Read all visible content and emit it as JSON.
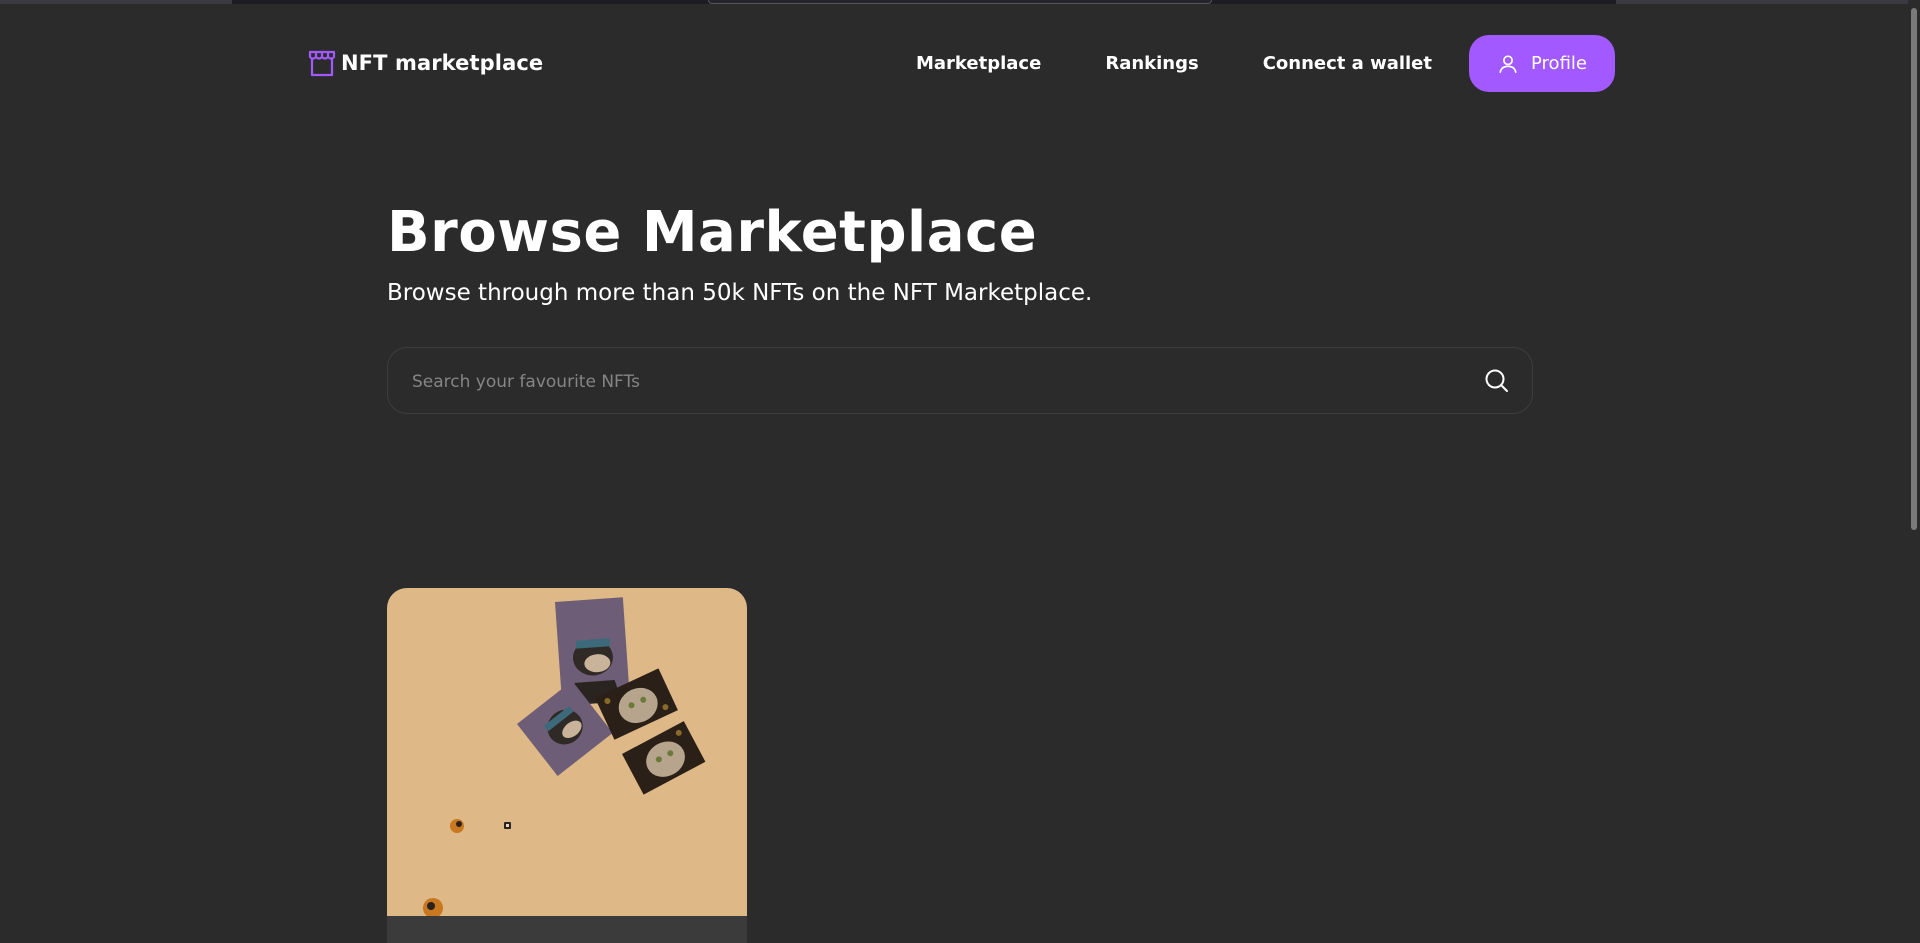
{
  "header": {
    "logo_text": "NFT marketplace",
    "logo_icon": "storefront-icon",
    "nav": [
      {
        "label": "Marketplace"
      },
      {
        "label": "Rankings"
      },
      {
        "label": "Connect a wallet"
      }
    ],
    "profile": {
      "label": "Profile",
      "icon": "user-icon"
    }
  },
  "hero": {
    "title": "Browse Marketplace",
    "subtitle": "Browse through more than 50k NFTs on the NFT Marketplace."
  },
  "search": {
    "placeholder": "Search your favourite NFTs",
    "value": "",
    "icon": "search-icon"
  },
  "colors": {
    "background": "#2b2b2b",
    "accent": "#a259ff",
    "card_bg": "#deb887",
    "card_footer": "#3b3b3b"
  }
}
